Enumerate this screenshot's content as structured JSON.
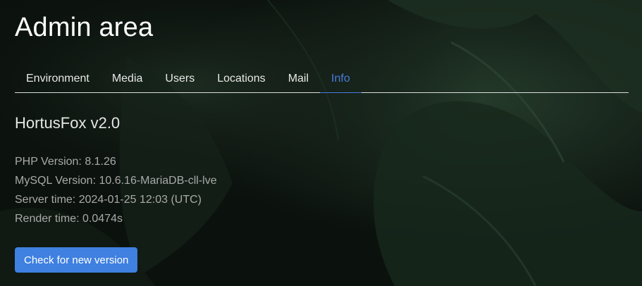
{
  "header": {
    "title": "Admin area"
  },
  "tabs": [
    {
      "label": "Environment",
      "active": false
    },
    {
      "label": "Media",
      "active": false
    },
    {
      "label": "Users",
      "active": false
    },
    {
      "label": "Locations",
      "active": false
    },
    {
      "label": "Mail",
      "active": false
    },
    {
      "label": "Info",
      "active": true
    }
  ],
  "info": {
    "app_version": "HortusFox v2.0",
    "php_version": "PHP Version: 8.1.26",
    "mysql_version": "MySQL Version: 10.6.16-MariaDB-cll-lve",
    "server_time": "Server time: 2024-01-25 12:03 (UTC)",
    "render_time": "Render time: 0.0474s",
    "check_button_label": "Check for new version"
  },
  "colors": {
    "accent": "#3f80e0",
    "active_tab": "#4a7bdc",
    "background": "#0b110d"
  }
}
